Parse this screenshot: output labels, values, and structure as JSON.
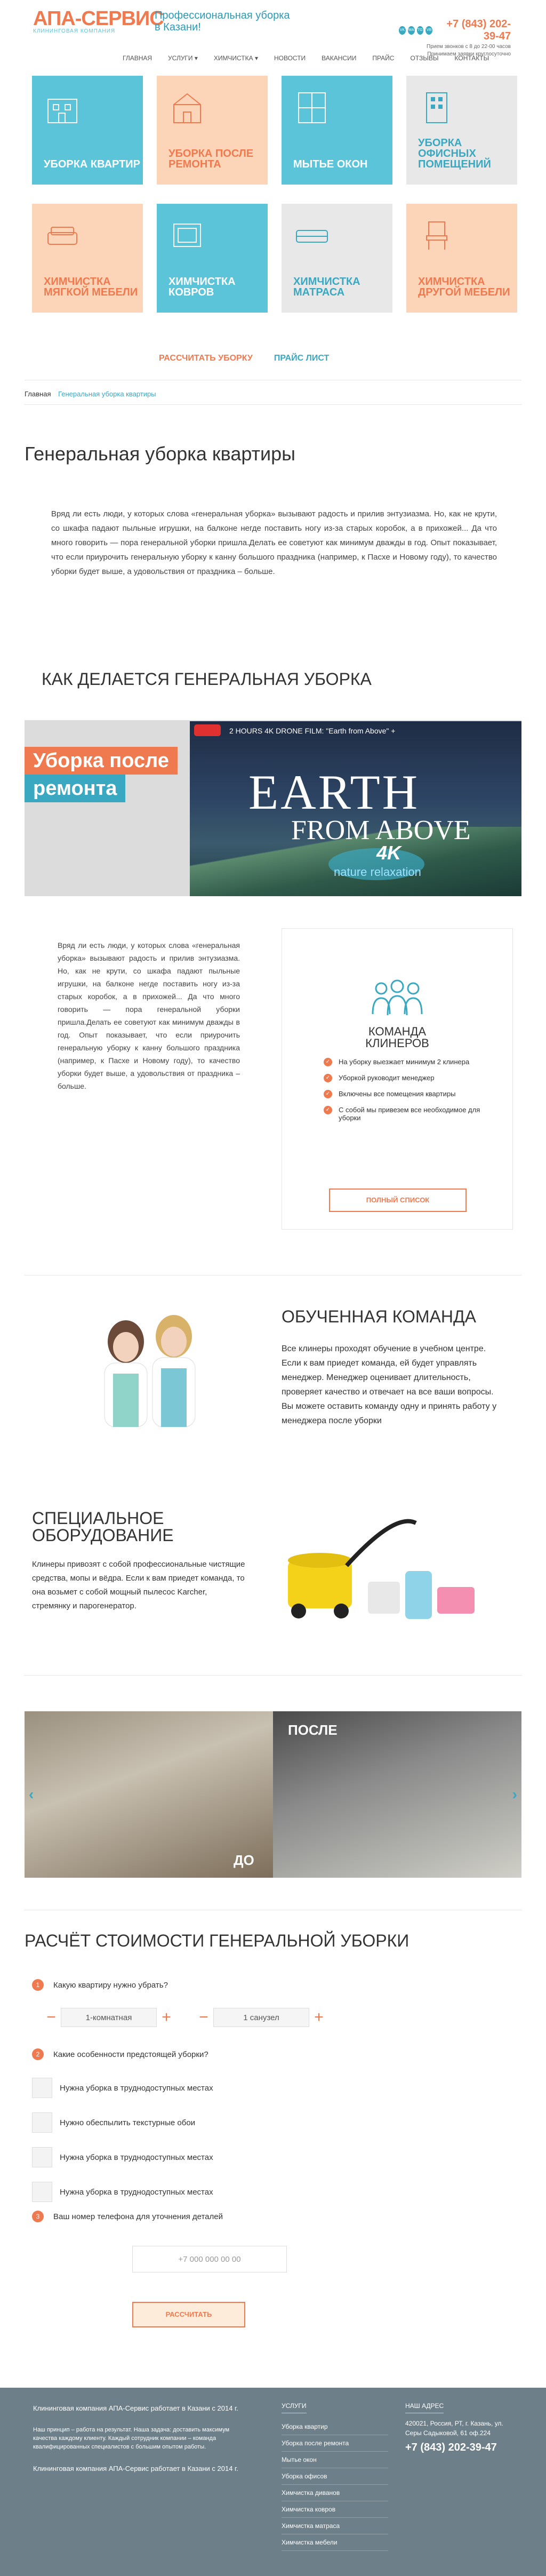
{
  "header": {
    "logo_main": "АПА-СЕРВИС",
    "logo_sub": "клининговая компания",
    "tagline": "Профессиональная уборка в Казани!",
    "phone": "+7 (843) 202-39-47",
    "note_line1": "Прием звонков с 8 до 22-00 часов",
    "note_line2": "Принимаем заявки круглосуточно",
    "socials": [
      "VK",
      "WA",
      "TG",
      "VB"
    ]
  },
  "nav": {
    "items": [
      {
        "label": "Главная"
      },
      {
        "label": "Услуги ▾"
      },
      {
        "label": "Химчистка ▾"
      },
      {
        "label": "Новости"
      },
      {
        "label": "Вакансии"
      },
      {
        "label": "Прайс"
      },
      {
        "label": "Отзывы"
      },
      {
        "label": "Контакты"
      }
    ]
  },
  "tiles": [
    {
      "label": "Уборка квартир",
      "bg": "#5bc4d9",
      "color": "#ffffff"
    },
    {
      "label": "Уборка после ремонта",
      "bg": "#fcd5b8",
      "color": "#f07a4f"
    },
    {
      "label": "Мытье окон",
      "bg": "#5bc4d9",
      "color": "#ffffff"
    },
    {
      "label": "Уборка офисных помещений",
      "bg": "#e8e8e8",
      "color": "#3aa8c1"
    },
    {
      "label": "Химчистка мягкой мебели",
      "bg": "#fcd5b8",
      "color": "#f07a4f"
    },
    {
      "label": "Химчистка ковров",
      "bg": "#5bc4d9",
      "color": "#ffffff"
    },
    {
      "label": "Химчистка матраса",
      "bg": "#e8e8e8",
      "color": "#3aa8c1"
    },
    {
      "label": "Химчистка другой мебели",
      "bg": "#fcd5b8",
      "color": "#f07a4f"
    }
  ],
  "actions": {
    "calc": "Рассчитать уборку",
    "price": "Прайс лист"
  },
  "breadcrumb": {
    "home": "Главная",
    "current": "Генеральная уборка квартиры"
  },
  "page": {
    "title": "Генеральная уборка квартиры",
    "intro": "Вряд ли есть люди, у которых слова «генеральная уборка» вызывают радость и прилив энтузиазма. Но, как не крути, со шкафа падают пыльные игрушки, на балконе негде поставить ногу из-за старых коробок, а в прихожей... Да что много говорить — пора генеральной уборки пришла.Делать ее советуют как минимум дважды в год. Опыт показывает, что если приурочить генеральную уборку к канну большого праздника (например, к Пасхе и Новому году), то качество уборки будет выше, а удовольствия от праздника – больше.",
    "how_title": "Как делается генеральная уборка"
  },
  "video_band": {
    "tag1": "Уборка после",
    "tag2": "ремонта",
    "video_title": "2 HOURS 4K DRONE FILM: \"Earth from Above\" +",
    "big1": "EARTH",
    "big2": "FROM ABOVE",
    "k4": "4K",
    "brand": "nature relaxation"
  },
  "body2": {
    "text": "Вряд ли есть люди, у которых слова «генеральная уборка» вызывают радость и прилив энтузиазма. Но, как не крути, со шкафа падают пыльные игрушки, на балконе негде поставить ногу из-за старых коробок, а в прихожей... Да что много говорить — пора генеральной уборки пришла.Делать ее советуют как минимум дважды в год. Опыт показывает, что если приурочить генеральную уборку к канну большого праздника (например, к Пасхе и Новому году), то качество уборки будет выше, а удовольствия от праздника – больше."
  },
  "team_card": {
    "title_line1": "Команда",
    "title_line2": "клинеров",
    "items": [
      "На уборку выезжает минимум 2 клинера",
      "Уборкой руководит менеджер",
      "Включены все помещения квартиры",
      "С собой мы привезем все необходимое для уборки"
    ],
    "button": "Полный список"
  },
  "trained": {
    "title": "Обученная команда",
    "text": "Все клинеры проходят обучение в учебном центре. Если к вам приедет команда, ей будет управлять менеджер. Менеджер оценивает длительность, проверяет качество и отвечает на все ваши вопросы. Вы можете оставить команду одну и принять работу у менеджера после уборки"
  },
  "equipment": {
    "title_line1": "Специальное",
    "title_line2": "оборудование",
    "text": "Клинеры привозят с собой профессиональные чистящие средства, мопы и вёдра. Если к вам приедет команда, то она возьмет с собой мощный пылесос Karcher, стремянку и парогенератор."
  },
  "slider": {
    "before": "ДО",
    "after": "ПОСЛЕ"
  },
  "calc": {
    "title": "Расчёт стоимости генеральной уборки",
    "q1": "Какую квартиру нужно убрать?",
    "q1_num": "1",
    "rooms": "1-комнатная",
    "baths": "1 санузел",
    "q2": "Какие особенности предстоящей уборки?",
    "q2_num": "2",
    "options": [
      "Нужна уборка в труднодоступных местах",
      "Нужно обеспылить текстурные обои",
      "Нужна уборка в труднодоступных местах",
      "Нужна уборка в труднодоступных местах"
    ],
    "q3": "Ваш номер телефона для уточнения деталей",
    "q3_num": "3",
    "phone_placeholder": "+7 000 000 00 00",
    "button": "Рассчитать"
  },
  "footer": {
    "about1": "Клининговая компания АПА-Сервис работает в Казани с 2014 г.",
    "about2": "Наш принцип – работа на результат. Наша задача: доставить максимум качества каждому клиенту. Каждый сотрудник компании – команда квалифицированных специалистов с большим опытом работы.",
    "about3": "Клининговая компания АПА-Сервис работает в Казани с 2014 г.",
    "services_title": "Услуги",
    "services": [
      "Уборка квартир",
      "Уборка после ремонта",
      "Мытье окон",
      "Уборка офисов",
      "Химчистка диванов",
      "Химчистка ковров",
      "Химчистка матраса",
      "Химчистка мебели"
    ],
    "address_title": "Наш адрес",
    "address": "420021, Россия, РТ, г. Казань, ул. Серы Садыковой, 61 оф.224",
    "phone": "+7 (843) 202-39-47"
  },
  "colors": {
    "orange": "#f07a4f",
    "teal": "#3aa8c1",
    "footer_bg": "#6d7f89"
  }
}
